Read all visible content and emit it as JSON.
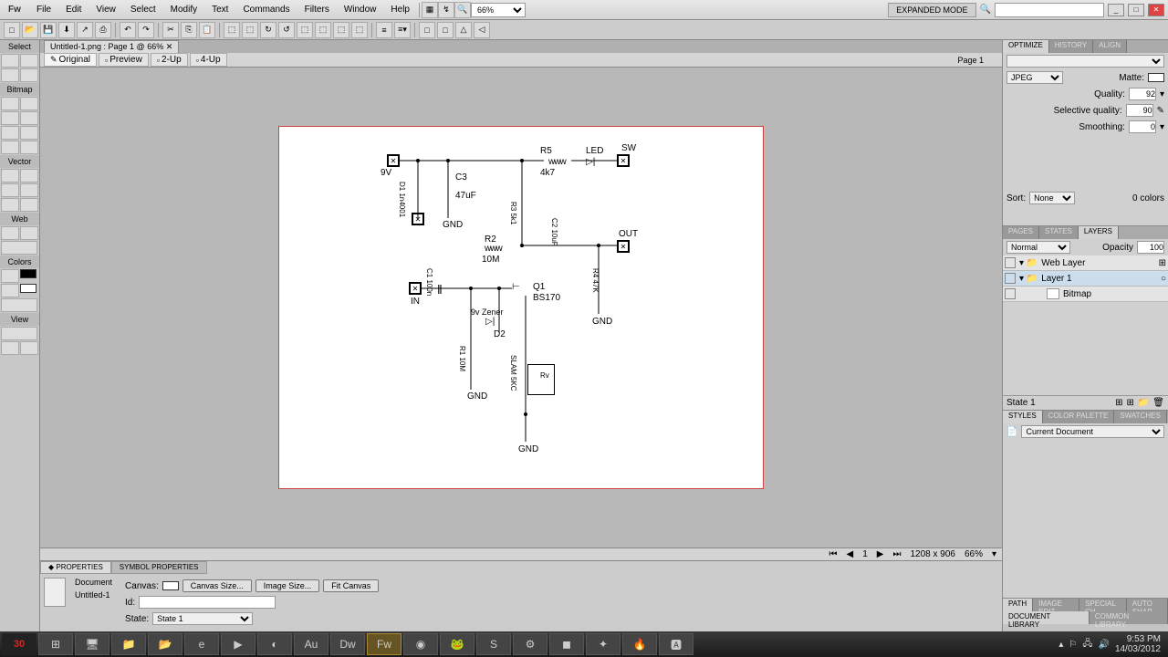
{
  "menubar": {
    "logo": "Fw",
    "items": [
      "File",
      "Edit",
      "View",
      "Select",
      "Modify",
      "Text",
      "Commands",
      "Filters",
      "Window",
      "Help"
    ],
    "zoom": "66%",
    "expanded_mode": "EXPANDED MODE",
    "search_placeholder": ""
  },
  "doc": {
    "tab": "Untitled-1.png : Page 1 @ 66% ✕",
    "page_label": "Page 1"
  },
  "view_tabs": {
    "original": "Original",
    "preview": "Preview",
    "two_up": "2-Up",
    "four_up": "4-Up"
  },
  "status": {
    "nav": "1",
    "dims": "1208 x 906",
    "zoom": "66%"
  },
  "properties": {
    "tab1": "◆ PROPERTIES",
    "tab2": "SYMBOL PROPERTIES",
    "doc_label": "Document",
    "doc_name": "Untitled-1",
    "canvas_label": "Canvas:",
    "canvas_size_btn": "Canvas Size...",
    "image_size_btn": "Image Size...",
    "fit_canvas_btn": "Fit Canvas",
    "id_label": "Id:",
    "state_label": "State:",
    "state_value": "State 1"
  },
  "optimize": {
    "tab1": "OPTIMIZE",
    "tab2": "HISTORY",
    "tab3": "ALIGN",
    "format": "JPEG",
    "matte_label": "Matte:",
    "quality_label": "Quality:",
    "quality": "92",
    "sel_quality_label": "Selective quality:",
    "sel_quality": "90",
    "smoothing_label": "Smoothing:",
    "smoothing": "0",
    "sort_label": "Sort:",
    "sort_value": "None",
    "colors": "0 colors"
  },
  "layers": {
    "tab1": "PAGES",
    "tab2": "STATES",
    "tab3": "LAYERS",
    "blend": "Normal",
    "opacity_label": "Opacity",
    "opacity": "100",
    "items": [
      "Web Layer",
      "Layer 1",
      "Bitmap"
    ],
    "state": "State 1"
  },
  "styles": {
    "tab1": "STYLES",
    "tab2": "COLOR PALETTE",
    "tab3": "SWATCHES",
    "source": "Current Document"
  },
  "doclib": {
    "tab1": "DOCUMENT LIBRARY",
    "tab2": "COMMON LIBRARY"
  },
  "tool_sections": {
    "select": "Select",
    "bitmap": "Bitmap",
    "vector": "Vector",
    "web": "Web",
    "colors": "Colors",
    "view": "View"
  },
  "tray": {
    "time": "9:53 PM",
    "date": "14/03/2012"
  },
  "schematic": {
    "R5": "R5",
    "R5ww": "ᴡᴡᴡ",
    "R5v": "4k7",
    "LED": "LED",
    "SW": "SW",
    "V9": "9V",
    "C3": "C3",
    "C3v": "47uF",
    "D1": "D1 1n4001",
    "GND1": "GND",
    "R3": "R3 5k1",
    "C2": "C2 10uF",
    "OUT": "OUT",
    "R2": "R2",
    "R2ww": "ᴡᴡᴡ",
    "R2v": "10M",
    "IN": "IN",
    "C1": "C1 100n",
    "Q1": "Q1",
    "Q1p": "BS170",
    "R4": "R4 47K",
    "GND2": "GND",
    "Zener": "9v Zener",
    "D2": "D2",
    "R1": "R1 10M",
    "GND3": "GND",
    "SLAM": "SLAM 5KC",
    "Rv": "Rv",
    "GND4": "GND"
  },
  "taskbar_icons": [
    "⊞",
    "🖥",
    "📁",
    "📂",
    "e",
    "▶",
    "◐",
    "Au",
    "Dw",
    "Fw",
    "◉",
    "🐸",
    "S",
    "⚙",
    "◼",
    "✦",
    "🔥",
    "🅰"
  ]
}
